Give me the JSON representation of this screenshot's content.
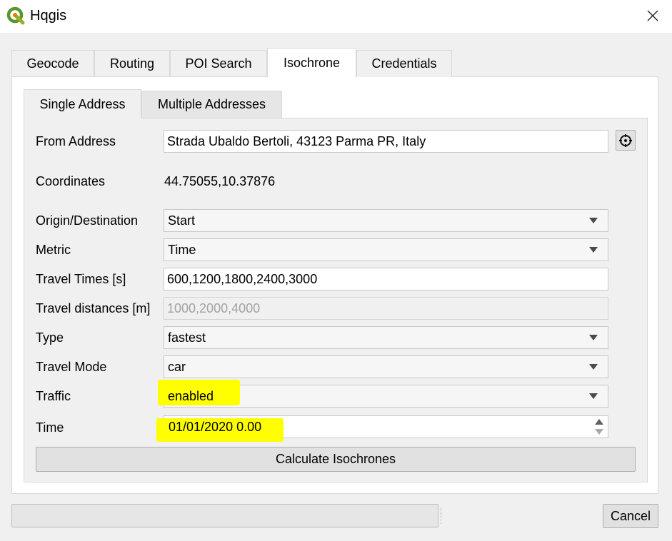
{
  "window": {
    "title": "Hqgis",
    "logo_icon": "qgis-logo-icon",
    "close_icon": "close-icon"
  },
  "tabs": [
    {
      "label": "Geocode",
      "active": false
    },
    {
      "label": "Routing",
      "active": false
    },
    {
      "label": "POI Search",
      "active": false
    },
    {
      "label": "Isochrone",
      "active": true
    },
    {
      "label": "Credentials",
      "active": false
    }
  ],
  "subtabs": [
    {
      "label": "Single Address",
      "active": true
    },
    {
      "label": "Multiple Addresses",
      "active": false
    }
  ],
  "form": {
    "from_address": {
      "label": "From Address",
      "value": "Strada Ubaldo Bertoli, 43123 Parma PR, Italy",
      "picker_icon": "crosshair-icon"
    },
    "coordinates": {
      "label": "Coordinates",
      "value": "44.75055,10.37876"
    },
    "origin_destination": {
      "label": "Origin/Destination",
      "value": "Start"
    },
    "metric": {
      "label": "Metric",
      "value": "Time"
    },
    "travel_times": {
      "label": "Travel Times [s]",
      "value": "600,1200,1800,2400,3000"
    },
    "travel_distances": {
      "label": "Travel distances [m]",
      "placeholder": "1000,2000,4000",
      "disabled": true
    },
    "type": {
      "label": "Type",
      "value": "fastest"
    },
    "travel_mode": {
      "label": "Travel Mode",
      "value": "car"
    },
    "traffic": {
      "label": "Traffic",
      "value": "enabled"
    },
    "time": {
      "label": "Time",
      "value": "01/01/2020 0.00"
    },
    "calculate_label": "Calculate Isochrones"
  },
  "footer": {
    "cancel_label": "Cancel",
    "progress": 0
  },
  "colors": {
    "highlight": "#ffff00",
    "window_bg": "#f0f0f0",
    "panel_bg": "#ffffff"
  }
}
